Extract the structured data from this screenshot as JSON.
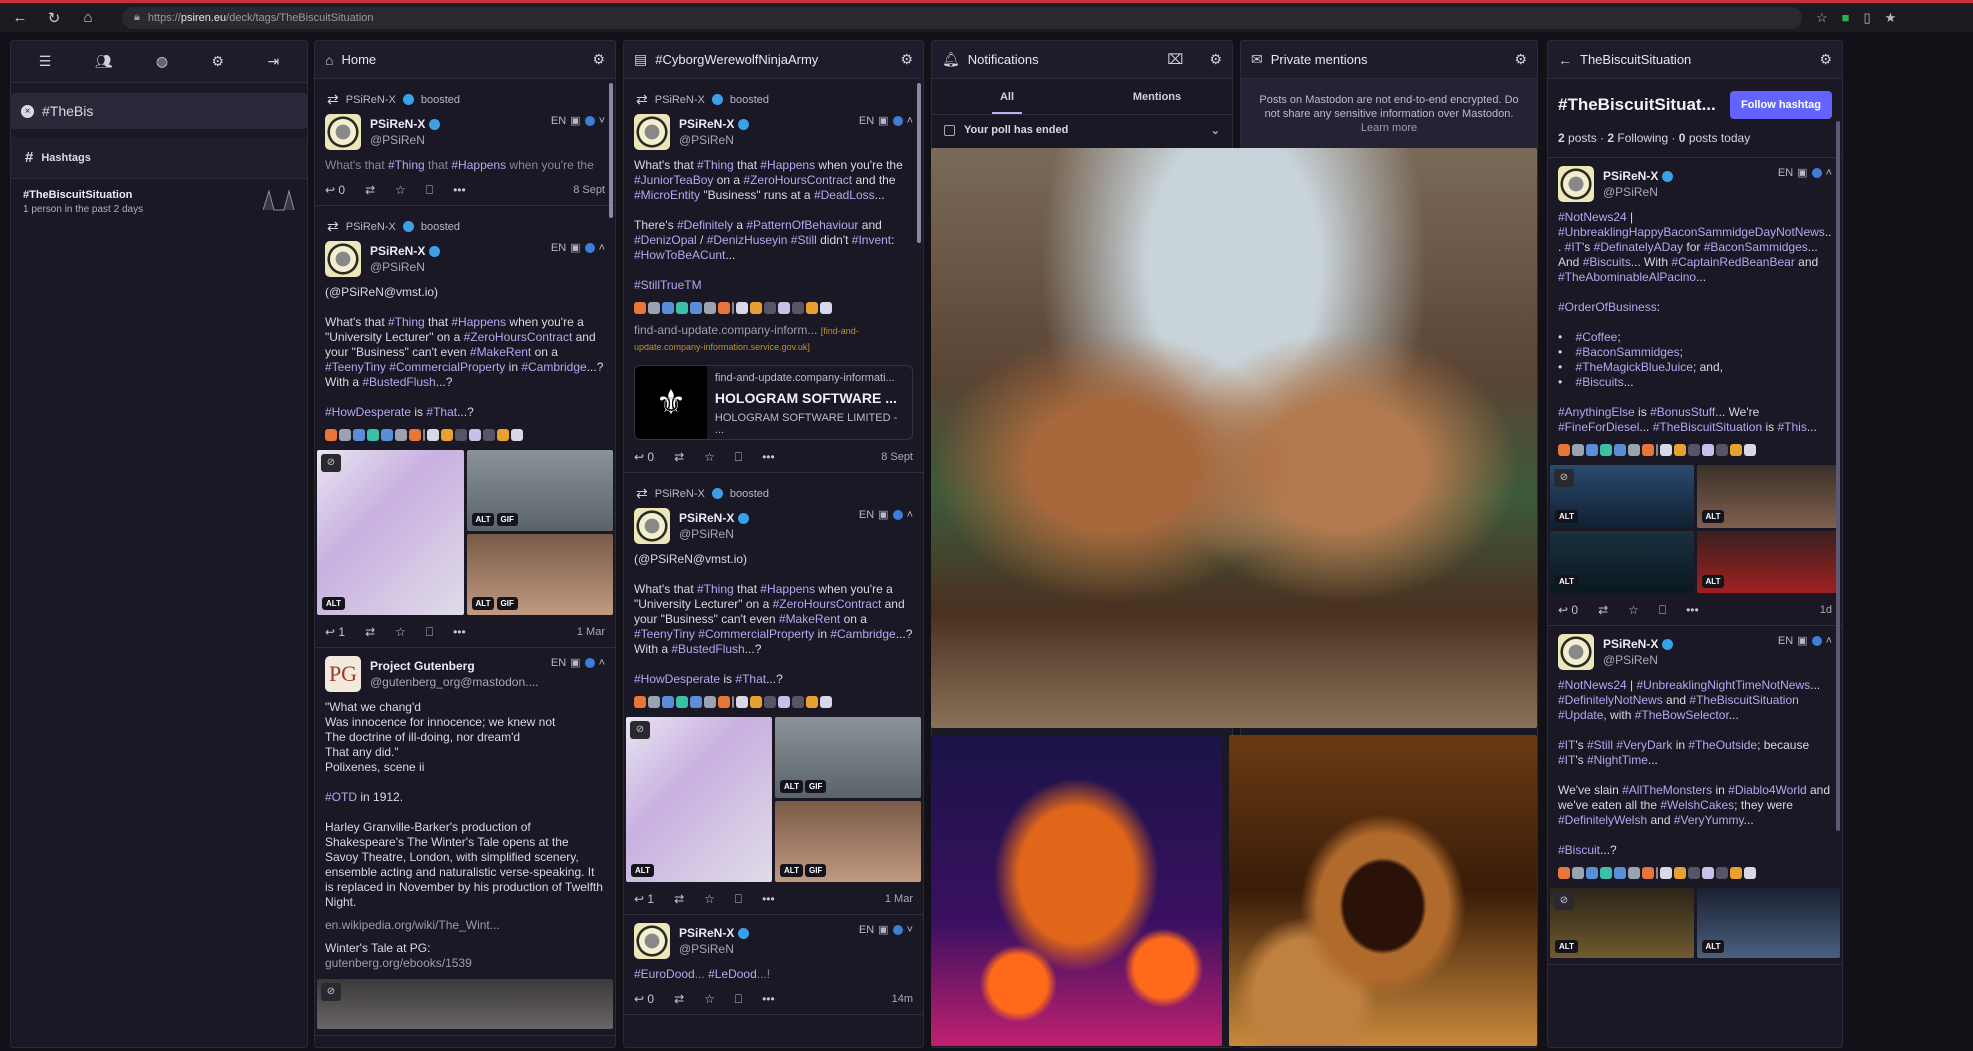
{
  "browser": {
    "url_prefix": "https://",
    "url_host": "psiren.eu",
    "url_path": "/deck/tags/TheBiscuitSituation"
  },
  "nav": {
    "search_value": "#TheBis",
    "hashtags_label": "Hashtags",
    "result": {
      "tag": "#TheBiscuitSituation",
      "sub": "1 person in the past 2 days"
    }
  },
  "columns": {
    "home": {
      "title": "Home"
    },
    "cyborg": {
      "title": "#CyborgWerewolfNinjaArmy"
    },
    "notifications": {
      "title": "Notifications",
      "tabs": [
        "All",
        "Mentions"
      ],
      "poll": "Your poll has ended"
    },
    "private": {
      "title": "Private mentions",
      "notice": "Posts on Mastodon are not end-to-end encrypted. Do not share any sensitive information over Mastodon.",
      "learn_more": "Learn more"
    },
    "tag": {
      "back_title": "TheBiscuitSituation",
      "heading": "#TheBiscuitSituat...",
      "follow": "Follow hashtag",
      "stats": {
        "posts_n": "2",
        "posts_l": "posts",
        "following_n": "2",
        "following_l": "Following",
        "today_n": "0",
        "today_l": "posts today"
      }
    }
  },
  "accent": "#6364ff",
  "posts": {
    "home": [
      {
        "boost": "PSiReN-X",
        "boost_label": "boosted",
        "name": "PSiReN-X",
        "handle": "@PSiReN",
        "lang": "EN",
        "chev": "down",
        "faded": true,
        "text": "What's that #Thing that #Happens when you're the",
        "replies": "0",
        "time": "8 Sept"
      },
      {
        "boost": "PSiReN-X",
        "boost_label": "boosted",
        "name": "PSiReN-X",
        "handle": "@PSiReN",
        "lang": "EN",
        "chev": "up",
        "text": "(@PSiReN@vmst.io)\n\nWhat's that #Thing that #Happens when you're a \"University Lecturer\" on a #ZeroHoursContract and your \"Business\" can't even #MakeRent on a #TeenyTiny #CommercialProperty in #Cambridge...? With a #BustedFlush...?\n\n#HowDesperate is #That...?",
        "emoji": true,
        "media": "ac",
        "replies": "1",
        "time": "1 Mar"
      },
      {
        "name": "Project Gutenberg",
        "handle": "@gutenberg_org@mastodon....",
        "lang": "EN",
        "chev": "up",
        "pg": true,
        "text": "\"What we chang'd\nWas innocence for innocence; we knew not\nThe doctrine of ill-doing, nor dream'd\nThat any did.\"\nPolixenes, scene ii\n\n#OTD in 1912.\n\nHarley Granville-Barker's production of Shakespeare's The Winter's Tale opens at the Savoy Theatre, London, with simplified scenery, ensemble acting and naturalistic verse-speaking. It is replaced in November by his production of Twelfth Night.",
        "links": [
          "en.wikipedia.org/wiki/The_Wint..."
        ],
        "after": "Winter's Tale at PG:",
        "after_link": "gutenberg.org/ebooks/1539",
        "media": "pg"
      }
    ],
    "cyborg": [
      {
        "boost": "PSiReN-X",
        "boost_label": "boosted",
        "name": "PSiReN-X",
        "handle": "@PSiReN",
        "lang": "EN",
        "chev": "up",
        "text": "What's that #Thing that #Happens when you're the #JuniorTeaBoy on a #ZeroHoursContract and the #MicroEntity \"Business\" runs at a #DeadLoss...\n\nThere's #Definitely a #PatternOfBehaviour and #DenizOpal / #DenizHuseyin #Still didn't #Invent: #HowToBeACunt...\n\n#StillTrueTM",
        "emoji": true,
        "linktext": "find-and-update.company-inform...",
        "linkdomain": "[find-and-update.company-information.service.gov.uk]",
        "card": {
          "domain": "find-and-update.company-informati...",
          "title": "HOLOGRAM SOFTWARE ...",
          "desc": "HOLOGRAM SOFTWARE LIMITED - ..."
        },
        "replies": "0",
        "time": "8 Sept"
      },
      {
        "boost": "PSiReN-X",
        "boost_label": "boosted",
        "name": "PSiReN-X",
        "handle": "@PSiReN",
        "lang": "EN",
        "chev": "up",
        "text": "(@PSiReN@vmst.io)\n\nWhat's that #Thing that #Happens when you're a \"University Lecturer\" on a #ZeroHoursContract and your \"Business\" can't even #MakeRent on a #TeenyTiny #CommercialProperty in #Cambridge...? With a #BustedFlush...?\n\n#HowDesperate is #That...?",
        "emoji": true,
        "media": "ac",
        "replies": "1",
        "time": "1 Mar"
      },
      {
        "name": "PSiReN-X",
        "handle": "@PSiReN",
        "lang": "EN",
        "chev": "down",
        "faded": true,
        "text": "#EuroDood... #LeDood...!",
        "replies": "0",
        "time": "14m"
      }
    ],
    "tag": [
      {
        "name": "PSiReN-X",
        "handle": "@PSiReN",
        "lang": "EN",
        "chev": "up",
        "text": "#NotNews24 | #UnbreaklingHappyBaconSammidgeDayNotNews... #IT's #DefinatelyADay for #BaconSammidges... And #Biscuits... With #CaptainRedBeanBear and #TheAbominableAlPacino...\n\n#OrderOfBusiness:\n\n•    #Coffee;\n•    #BaconSammidges;\n•    #TheMagickBlueJuice; and,\n•    #Biscuits...\n\n#AnythingElse is #BonusStuff... We're #FineForDiesel... #TheBiscuitSituation is #This...",
        "emoji": true,
        "media": "four",
        "replies": "0",
        "time": "1d"
      },
      {
        "name": "PSiReN-X",
        "handle": "@PSiReN",
        "lang": "EN",
        "chev": "up",
        "text": "#NotNews24 | #UnbreaklingNightTimeNotNews... #DefinitelyNotNews and #TheBiscuitSituation #Update, with #TheBowSelector...\n\n#IT's #Still #VeryDark in #TheOutside; because #IT's #NightTime...\n\nWe've slain #AllTheMonsters in #Diablo4World and we've eaten all the #WelshCakes; they were #DefinitelyWelsh and #VeryYummy...\n\n#Biscuit...?",
        "emoji": true,
        "media": "two"
      }
    ]
  },
  "labels": {
    "alt": "ALT",
    "gif": "GIF"
  }
}
